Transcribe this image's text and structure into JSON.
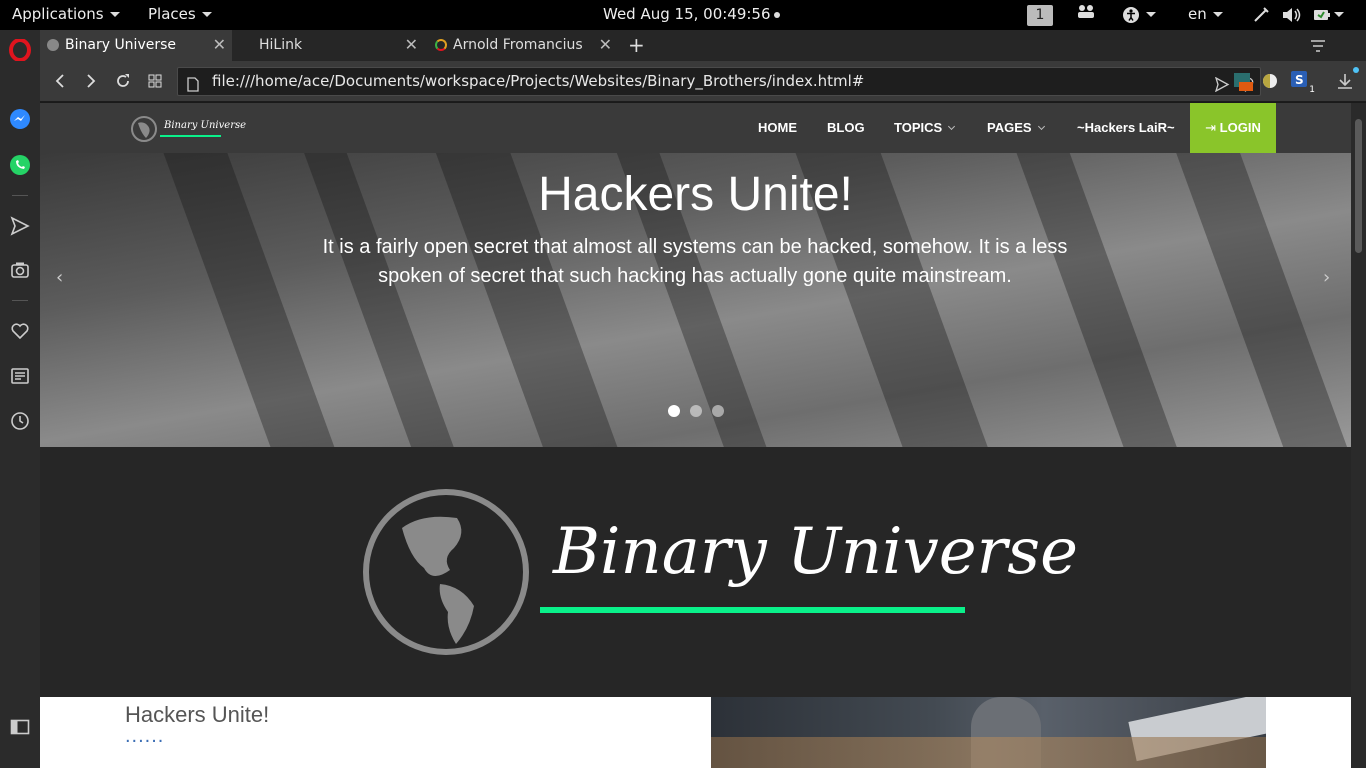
{
  "topbar": {
    "applications": "Applications",
    "places": "Places",
    "clock": "Wed Aug 15, 00:49:56",
    "workspace": "1",
    "language": "en"
  },
  "tabs": [
    {
      "title": "Binary Universe"
    },
    {
      "title": "HiLink"
    },
    {
      "title": "Arnold Fromancius"
    }
  ],
  "address": {
    "url": "file:///home/ace/Documents/workspace/Projects/Websites/Binary_Brothers/index.html#"
  },
  "extensions": {
    "badge_count": "1"
  },
  "site": {
    "logo_text": "Binary Universe",
    "nav": [
      "HOME",
      "BLOG",
      "TOPICS",
      "PAGES",
      "~Hackers LaiR~"
    ],
    "login": "LOGIN"
  },
  "hero": {
    "title": "Hackers Unite!",
    "text": "It is a fairly open secret that almost all systems can be hacked, somehow. It is a less spoken of secret that such hacking has actually gone quite mainstream.",
    "slides": 3,
    "active_slide": 1
  },
  "brand": {
    "name": "Binary Universe",
    "accent": "#0af08a"
  },
  "content": {
    "title": "Hackers Unite!",
    "dots": "......"
  },
  "colors": {
    "login_bg": "#8ac52a",
    "navbar_bg": "#3a3a3a",
    "logo_band_bg": "#262626"
  }
}
